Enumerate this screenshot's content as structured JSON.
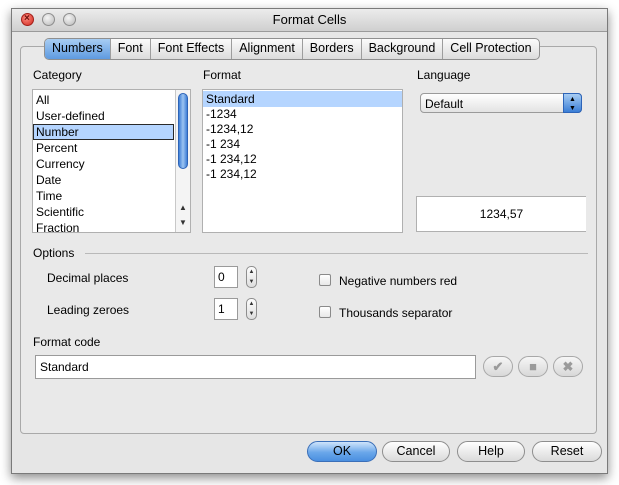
{
  "window": {
    "title": "Format Cells"
  },
  "tabs": [
    "Numbers",
    "Font",
    "Font Effects",
    "Alignment",
    "Borders",
    "Background",
    "Cell Protection"
  ],
  "active_tab": "Numbers",
  "category": {
    "label": "Category",
    "items": [
      "All",
      "User-defined",
      "Number",
      "Percent",
      "Currency",
      "Date",
      "Time",
      "Scientific",
      "Fraction"
    ],
    "selected": "Number"
  },
  "format": {
    "label": "Format",
    "items": [
      "Standard",
      "-1234",
      "-1234,12",
      "-1 234",
      "-1 234,12",
      "-1 234,12"
    ],
    "selected": "Standard"
  },
  "language": {
    "label": "Language",
    "value": "Default"
  },
  "preview": {
    "value": "1234,57"
  },
  "options": {
    "label": "Options",
    "decimal_places": {
      "label": "Decimal places",
      "value": "0"
    },
    "leading_zeroes": {
      "label": "Leading zeroes",
      "value": "1"
    },
    "negative_red": {
      "label": "Negative numbers red",
      "checked": false
    },
    "thousands_separator": {
      "label": "Thousands separator",
      "checked": false
    }
  },
  "format_code": {
    "label": "Format code",
    "value": "Standard"
  },
  "buttons": {
    "ok": "OK",
    "cancel": "Cancel",
    "help": "Help",
    "reset": "Reset"
  },
  "colors": {
    "selection": "#b5d5ff",
    "accent": "#5e9ae0"
  }
}
